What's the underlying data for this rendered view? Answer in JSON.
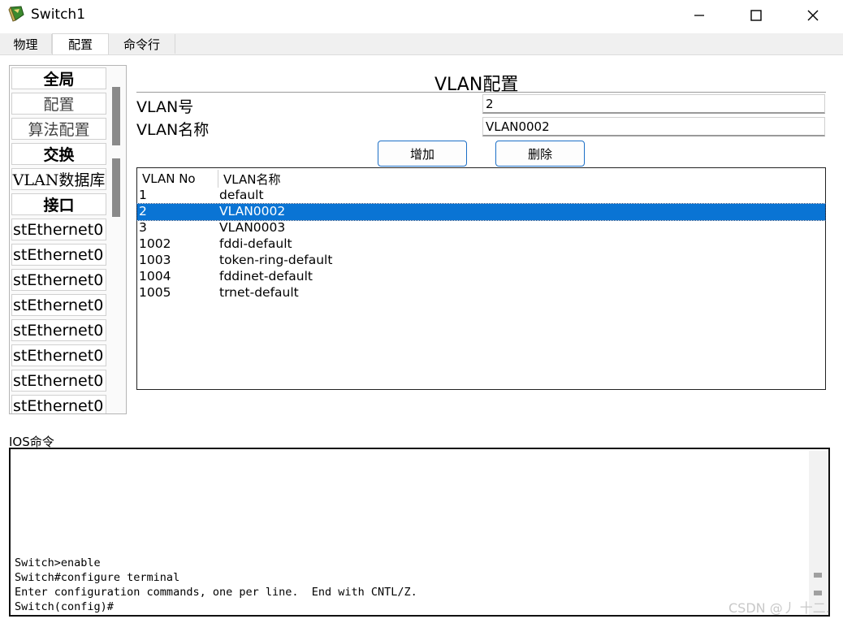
{
  "window": {
    "title": "Switch1",
    "controls": {
      "minimize": "—",
      "maximize": "☐",
      "close": "✕"
    },
    "icon": "switch-app-icon"
  },
  "tabs": [
    {
      "label": "物理",
      "active": false
    },
    {
      "label": "配置",
      "active": true
    },
    {
      "label": "命令行",
      "active": false
    }
  ],
  "sidebar": {
    "items": [
      {
        "label": "全局",
        "kind": "header"
      },
      {
        "label": "配置",
        "kind": "sub"
      },
      {
        "label": "算法配置",
        "kind": "sub"
      },
      {
        "label": "交换",
        "kind": "header"
      },
      {
        "label": "VLAN数据库",
        "kind": "sub"
      },
      {
        "label": "接口",
        "kind": "header"
      },
      {
        "label": "stEthernet0",
        "kind": "eth"
      },
      {
        "label": "stEthernet0",
        "kind": "eth"
      },
      {
        "label": "stEthernet0",
        "kind": "eth"
      },
      {
        "label": "stEthernet0",
        "kind": "eth"
      },
      {
        "label": "stEthernet0",
        "kind": "eth"
      },
      {
        "label": "stEthernet0",
        "kind": "eth"
      },
      {
        "label": "stEthernet0",
        "kind": "eth"
      },
      {
        "label": "stEthernet0",
        "kind": "eth"
      }
    ]
  },
  "vlan": {
    "title": "VLAN配置",
    "number_label": "VLAN号",
    "number_value": "2",
    "name_label": "VLAN名称",
    "name_value": "VLAN0002",
    "add_label": "增加",
    "delete_label": "删除",
    "table": {
      "columns": [
        "VLAN No",
        "VLAN名称"
      ],
      "selected_index": 1,
      "rows": [
        [
          "1",
          "default"
        ],
        [
          "2",
          "VLAN0002"
        ],
        [
          "3",
          "VLAN0003"
        ],
        [
          "1002",
          "fddi-default"
        ],
        [
          "1003",
          "token-ring-default"
        ],
        [
          "1004",
          "fddinet-default"
        ],
        [
          "1005",
          "trnet-default"
        ]
      ]
    }
  },
  "ios": {
    "label": "IOS命令",
    "lines": [
      "Switch>enable",
      "Switch#configure terminal",
      "Enter configuration commands, one per line.  End with CNTL/Z.",
      "Switch(config)#"
    ]
  },
  "watermark": "CSDN @丿 十二.",
  "colors": {
    "selection": "#0a74d4",
    "button_border": "#1c6fc7"
  }
}
